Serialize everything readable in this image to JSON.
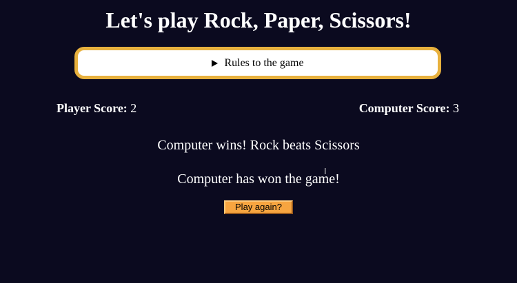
{
  "header": {
    "title": "Let's play Rock, Paper, Scissors!"
  },
  "rules": {
    "label": "Rules to the game",
    "icon": "disclosure-triangle-icon",
    "expanded": false
  },
  "scores": {
    "player_label": "Player Score:",
    "player_value": "2",
    "computer_label": "Computer Score:",
    "computer_value": "3"
  },
  "messages": {
    "round_result": "Computer wins! Rock beats Scissors",
    "game_result": "Computer has won the game!"
  },
  "actions": {
    "play_again_label": "Play again?"
  },
  "colors": {
    "background": "#0b0a1f",
    "rules_border": "#e8b13e",
    "button": "#f7a540",
    "text": "#ffffff"
  }
}
